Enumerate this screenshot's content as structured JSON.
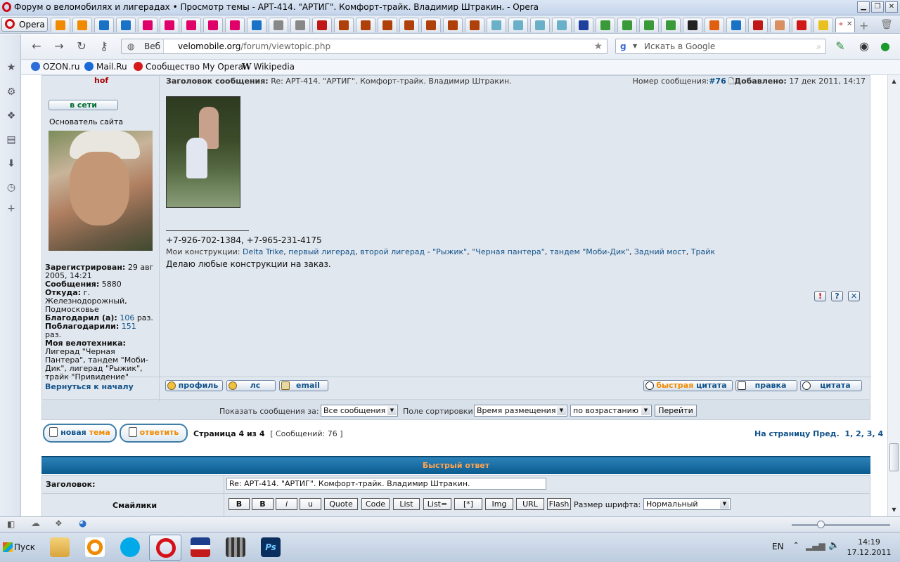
{
  "window": {
    "title": "Форум о веломобилях и лигерадах • Просмотр темы - АРТ-414. \"АРТИГ\". Комфорт-трайк. Владимир Штракин. - Opera"
  },
  "browser": {
    "menu_label": "Opera",
    "address_segment": "Веб",
    "url_host": "velomobile.org",
    "url_path": "/forum/viewtopic.php",
    "search_placeholder": "Искать в Google",
    "bookmarks": [
      "OZON.ru",
      "Mail.Ru",
      "Сообщество My Opera",
      "Wikipedia"
    ]
  },
  "post": {
    "username": "hof",
    "online_label": "в сети",
    "rank": "Основатель сайта",
    "profile": {
      "registered_label": "Зарегистрирован:",
      "registered_value": "29 авг 2005, 14:21",
      "posts_label": "Сообщения:",
      "posts_value": "5880",
      "from_label": "Откуда:",
      "from_value": "г. Железнодорожный, Подмосковье",
      "thanked_label": "Благодарил (а):",
      "thanked_count": "106",
      "thanked_suffix": "раз.",
      "was_thanked_label": "Поблагодарили:",
      "was_thanked_count": "151",
      "was_thanked_suffix": "раз.",
      "tech_label": "Моя велотехника:",
      "tech_value": "Лигерад \"Черная Пантера\", тандем \"Моби-Дик\", лигерад \"Рыжик\", трайк \"Привидение\""
    },
    "subject_label": "Заголовок сообщения:",
    "subject_value": "Re: АРТ-414. \"АРТИГ\". Комфорт-трайк. Владимир Штракин.",
    "number_label": "Номер сообщения:",
    "number_value": "#76",
    "added_label": "Добавлено:",
    "added_value": "17 дек 2011, 14:17",
    "phone": "+7-926-702-1384, +7-965-231-4175",
    "constructions_label": "Мои конструкции:",
    "constructions": [
      "Delta Trike",
      "первый лигерад",
      "второй лигерад - \"Рыжик\"",
      "\"Черная пантера\"",
      "тандем \"Моби-Дик\"",
      "Задний мост",
      "Трайк"
    ],
    "order_text": "Делаю любые конструкции на заказ.",
    "action_icons": [
      "!",
      "?",
      "✕"
    ],
    "back_to_top": "Вернуться к началу",
    "buttons": {
      "profile": "профиль",
      "pm": "лс",
      "email": "email",
      "quick_quote_a": "быстрая",
      "quick_quote_b": "цитата",
      "edit": "правка",
      "quote": "цитата"
    }
  },
  "sort": {
    "show_label": "Показать сообщения за:",
    "show_value": "Все сообщения",
    "sort_label": "Поле сортировки",
    "sort_value": "Время размещения",
    "order_value": "по возрастанию",
    "go_label": "Перейти"
  },
  "pagination": {
    "new_topic_a": "новая",
    "new_topic_b": "тема",
    "reply": "ответить",
    "page_info": "Страница 4 из 4",
    "count_info": "[ Сообщений: 76 ]",
    "nav_label": "На страницу",
    "prev": "Пред.",
    "pages": [
      "1",
      "2",
      "3",
      "4"
    ]
  },
  "quick_reply": {
    "header": "Быстрый ответ",
    "subject_label": "Заголовок:",
    "subject_value": "Re: АРТ-414. \"АРТИГ\". Комфорт-трайк. Владимир Штракин.",
    "smilies_label": "Смайлики",
    "format_buttons": [
      "B",
      "B",
      "i",
      "u",
      "Quote",
      "Code",
      "List",
      "List=",
      "[*]",
      "Img",
      "URL",
      "Flash"
    ],
    "font_size_label": "Размер шрифта:",
    "font_size_value": "Нормальный"
  },
  "taskbar": {
    "start_label": "Пуск",
    "lang": "EN",
    "time": "14:19",
    "date": "17.12.2011"
  }
}
